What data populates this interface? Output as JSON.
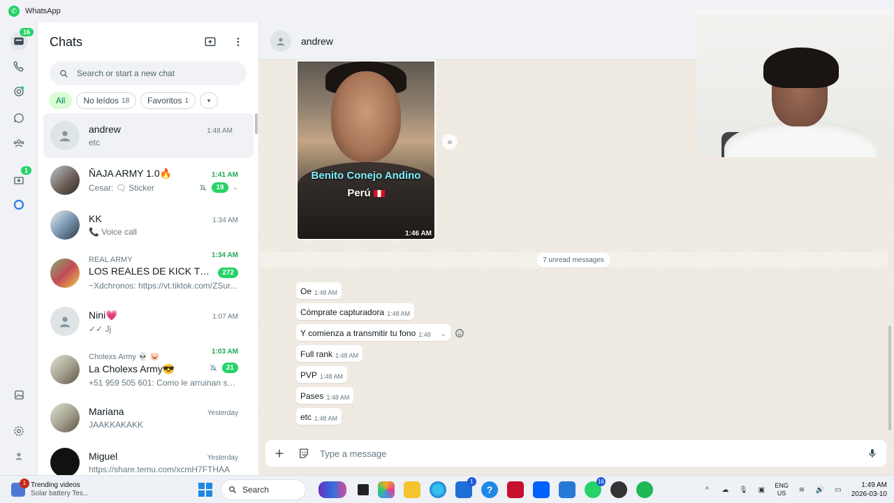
{
  "app": {
    "title": "WhatsApp"
  },
  "rail": {
    "chats_badge": "16",
    "archived_badge": "1"
  },
  "chat_panel": {
    "title": "Chats",
    "search_placeholder": "Search or start a new chat",
    "filters": [
      {
        "label": "All",
        "count": ""
      },
      {
        "label": "No leídos",
        "count": "18"
      },
      {
        "label": "Favoritos",
        "count": "1"
      }
    ],
    "chats": [
      {
        "name": "andrew",
        "time": "1:48 AM",
        "preview": "etc"
      },
      {
        "name": "ÑAJA ARMY 1.0🔥",
        "time": "1:41 AM",
        "preview": "Cesar: 🗨 Sticker",
        "unread": "19"
      },
      {
        "name": "KK",
        "time": "1:34 AM",
        "preview": "📞 Voice call"
      },
      {
        "group": "REAL ARMY",
        "name": "LOS REALES DE KICK TOK 👑",
        "time": "1:34 AM",
        "preview": "~Xdchronos: https://vt.tiktok.com/ZSur...",
        "unread": "272"
      },
      {
        "name": "Nini💗",
        "time": "1:07 AM",
        "preview": "✓✓ Jj"
      },
      {
        "group": "Cholexs Army 💀 🐷",
        "name": "La Cholexs Army😎",
        "time": "1:03 AM",
        "preview": "+51 959 505 601: Como le arruinan su ...",
        "unread": "21"
      },
      {
        "name": "Mariana",
        "time": "Yesterday",
        "preview": "JAAKKAKAKK"
      },
      {
        "name": "Miguel",
        "time": "Yesterday",
        "preview": "https://share.temu.com/xcmH7FTHAA"
      }
    ]
  },
  "conversation": {
    "contact_name": "andrew",
    "media": {
      "caption_line1": "Benito Conejo Andino",
      "caption_line2": "Perú",
      "time": "1:46 AM"
    },
    "unread_label": "7 unread messages",
    "messages": [
      {
        "text": "Oe",
        "time": "1:48 AM"
      },
      {
        "text": "Cómprate capturadora",
        "time": "1:48 AM"
      },
      {
        "text": "Y comienza a transmitir tu fono",
        "time": "1:48"
      },
      {
        "text": "Full rank",
        "time": "1:48 AM"
      },
      {
        "text": "PVP",
        "time": "1:48 AM"
      },
      {
        "text": "Pases",
        "time": "1:48 AM"
      },
      {
        "text": "etc",
        "time": "1:48 AM"
      }
    ],
    "composer_placeholder": "Type a message"
  },
  "taskbar": {
    "news_title": "Trending videos",
    "news_sub": "Solar battery Tes...",
    "news_badge": "1",
    "search_label": "Search",
    "store_badge": "1",
    "whatsapp_badge": "16",
    "lang_line1": "ENG",
    "lang_line2": "US",
    "time": "1:49 AM",
    "date": "2026-03-10"
  },
  "colors": {
    "accent": "#25d366",
    "chip_active_bg": "#d9fdd3",
    "chat_bg": "#efeae2"
  }
}
